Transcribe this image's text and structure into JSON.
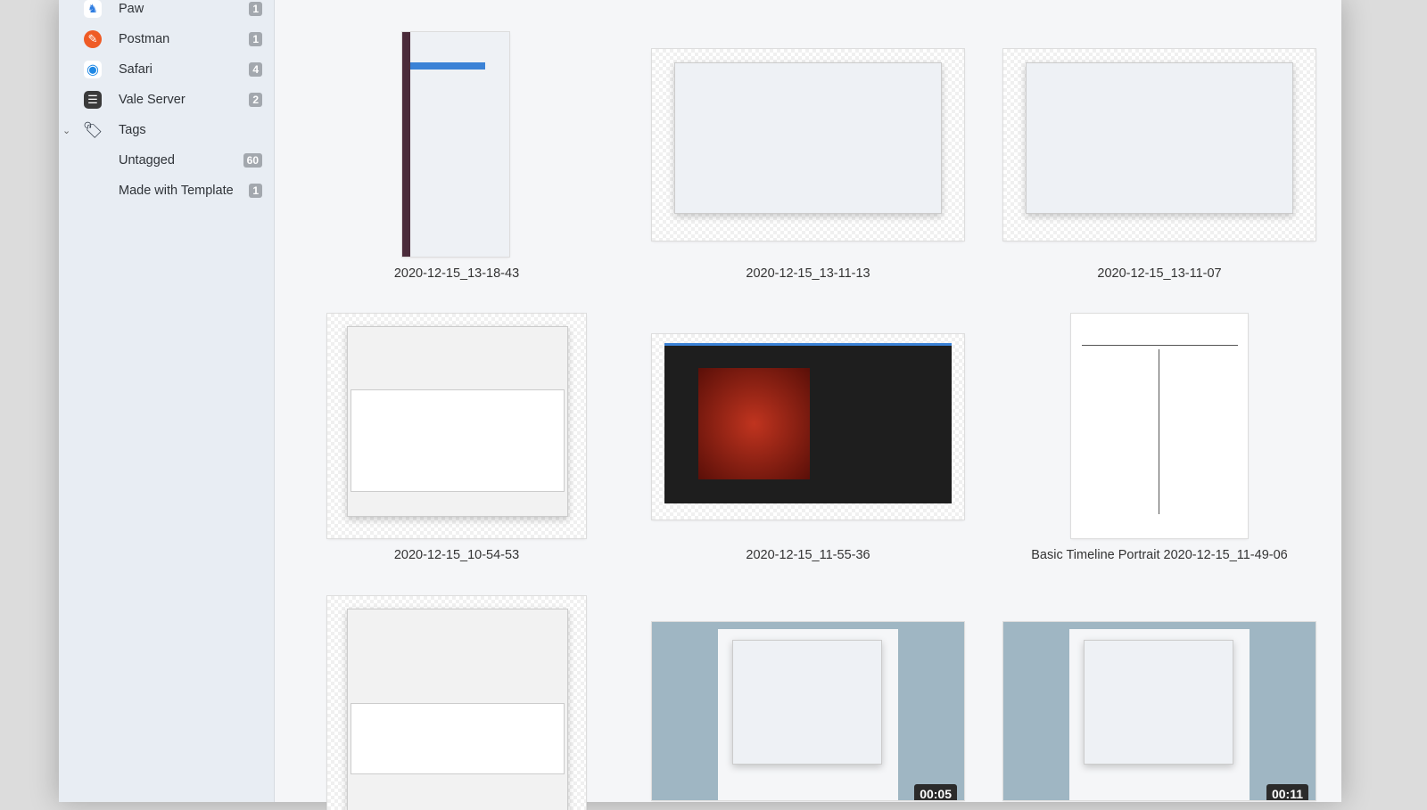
{
  "sidebar": {
    "items": [
      {
        "label": "Paw",
        "count": "1",
        "icon": "paw-app-icon",
        "color": "#2f7de1"
      },
      {
        "label": "Postman",
        "count": "1",
        "icon": "postman-app-icon",
        "color": "#ef5b25"
      },
      {
        "label": "Safari",
        "count": "4",
        "icon": "safari-app-icon",
        "color": "#1e88e5"
      },
      {
        "label": "Vale Server",
        "count": "2",
        "icon": "vale-server-app-icon",
        "color": "#3a3a3a"
      },
      {
        "label": "Tags",
        "count": "",
        "icon": "tag-icon",
        "color": "#2b3440"
      },
      {
        "label": "Untagged",
        "count": "60"
      },
      {
        "label": "Made with Template",
        "count": "1"
      }
    ]
  },
  "grid": [
    {
      "caption": "2020-12-15_13-18-43"
    },
    {
      "caption": "2020-12-15_13-11-13"
    },
    {
      "caption": "2020-12-15_13-11-07"
    },
    {
      "caption": "2020-12-15_10-54-53"
    },
    {
      "caption": "2020-12-15_11-55-36"
    },
    {
      "caption": "Basic Timeline Portrait 2020-12-15_11-49-06"
    },
    {
      "caption": ""
    },
    {
      "caption": "",
      "duration": "00:05"
    },
    {
      "caption": "",
      "duration": "00:11"
    }
  ]
}
